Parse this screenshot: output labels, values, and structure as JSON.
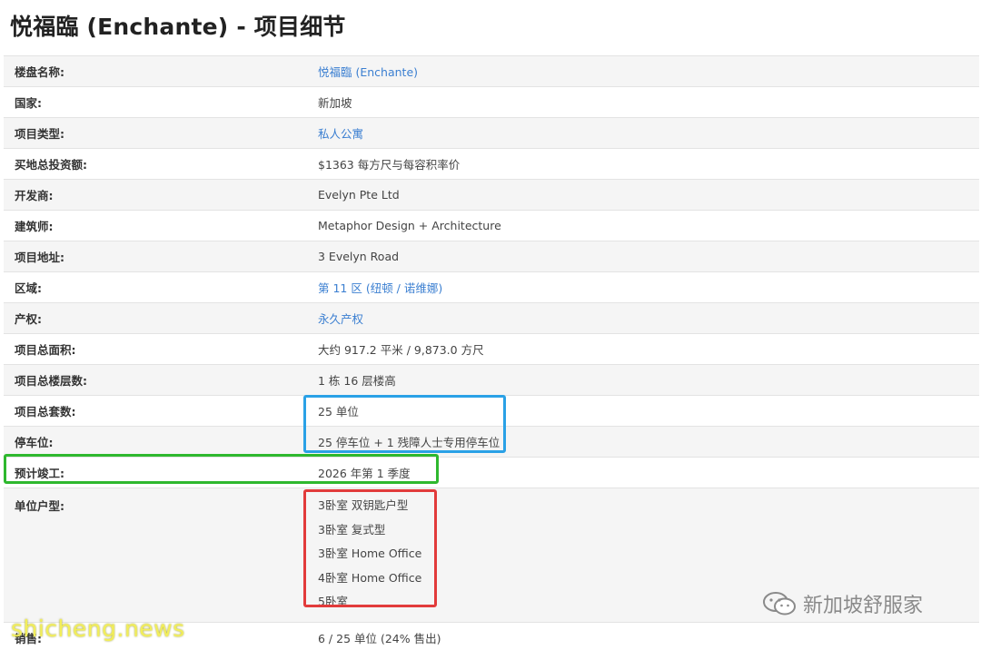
{
  "page_title": "悦福臨 (Enchante) - 项目细节",
  "rows": [
    {
      "label": "楼盘名称:",
      "value": "悦福臨 (Enchante)"
    },
    {
      "label": "国家:",
      "value": "新加坡"
    },
    {
      "label": "项目类型:",
      "value": "私人公寓"
    },
    {
      "label": "买地总投资额:",
      "value": "$1363 每方尺与每容积率价"
    },
    {
      "label": "开发商:",
      "value": "Evelyn Pte Ltd"
    },
    {
      "label": "建筑师:",
      "value": "Metaphor Design + Architecture"
    },
    {
      "label": "项目地址:",
      "value": "3 Evelyn Road"
    },
    {
      "label": "区域:",
      "value": "第 11 区 (纽顿 / 诺维娜)"
    },
    {
      "label": "产权:",
      "value": "永久产权"
    },
    {
      "label": "项目总面积:",
      "value": "大约 917.2 平米 / 9,873.0 方尺"
    },
    {
      "label": "项目总楼层数:",
      "value": "1 栋 16 层楼高"
    },
    {
      "label": "项目总套数:",
      "value": "25 单位"
    },
    {
      "label": "停车位:",
      "value": "25 停车位 + 1 残障人士专用停车位"
    },
    {
      "label": "预计竣工:",
      "value": "2026 年第 1 季度"
    }
  ],
  "unit_types": {
    "label": "单位户型:",
    "items": [
      "3卧室 双钥匙户型",
      "3卧室 复式型",
      "3卧室 Home Office",
      "4卧室 Home Office",
      "5卧室"
    ]
  },
  "sales": {
    "label": "销售:",
    "value": "6 / 25 单位 (24% 售出)"
  },
  "watermarks": {
    "wechat_account": "新加坡舒服家",
    "site": "shicheng.news"
  },
  "colors": {
    "link": "#3b7fd1",
    "highlight_blue": "#2aa1e6",
    "highlight_green": "#2eb82e",
    "highlight_red": "#e23b3b"
  }
}
